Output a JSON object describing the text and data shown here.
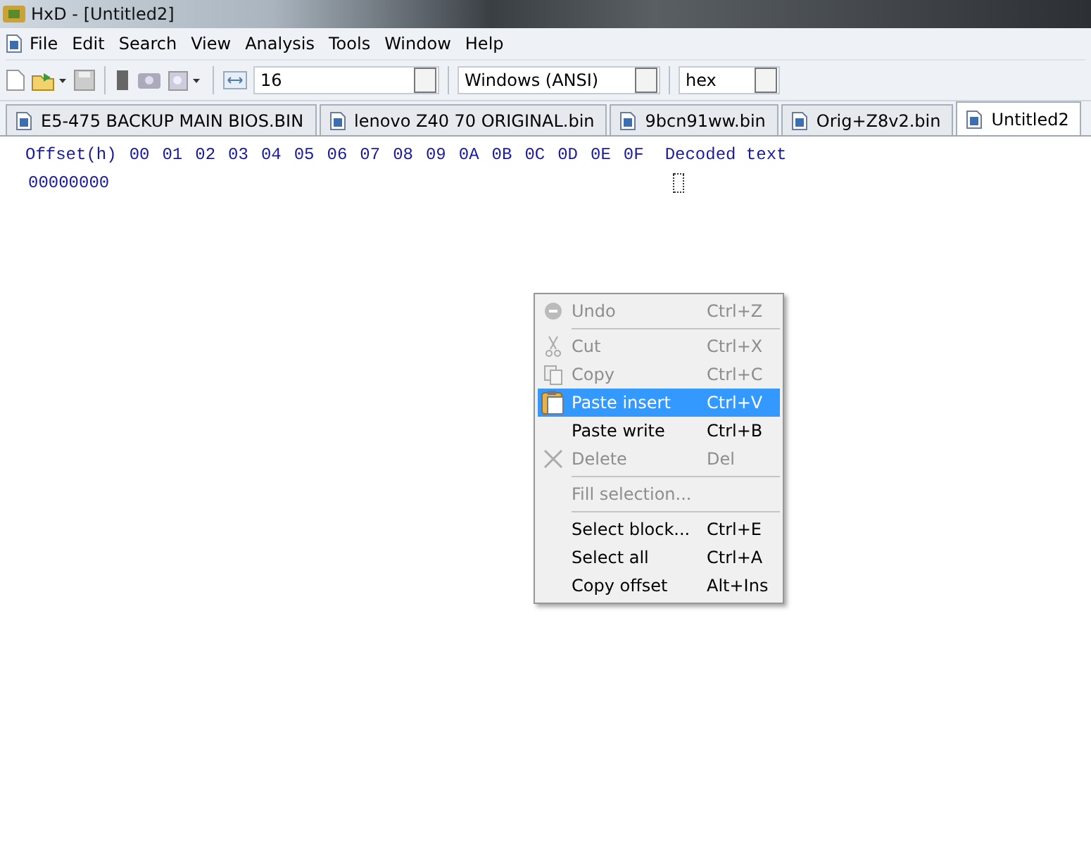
{
  "window": {
    "title": "HxD - [Untitled2]"
  },
  "menu_bar": [
    "File",
    "Edit",
    "Search",
    "View",
    "Analysis",
    "Tools",
    "Window",
    "Help"
  ],
  "toolbar": {
    "bytes_per_row": "16",
    "charset": "Windows (ANSI)",
    "offset_base": "hex"
  },
  "tabs": [
    {
      "label": "E5-475 BACKUP MAIN BIOS.BIN",
      "selected": false
    },
    {
      "label": "lenovo Z40 70 ORIGINAL.bin",
      "selected": false
    },
    {
      "label": "9bcn91ww.bin",
      "selected": false
    },
    {
      "label": "Orig+Z8v2.bin",
      "selected": false
    },
    {
      "label": "Untitled2",
      "selected": true
    }
  ],
  "hex_view": {
    "offset_header": "Offset(h)",
    "columns": [
      "00",
      "01",
      "02",
      "03",
      "04",
      "05",
      "06",
      "07",
      "08",
      "09",
      "0A",
      "0B",
      "0C",
      "0D",
      "0E",
      "0F"
    ],
    "decoded_header": "Decoded text",
    "rows": [
      "00000000"
    ]
  },
  "context_menu": [
    {
      "kind": "item",
      "label": "Undo",
      "shortcut": "Ctrl+Z",
      "disabled": true,
      "selected": false
    },
    {
      "kind": "separator"
    },
    {
      "kind": "item",
      "label": "Cut",
      "shortcut": "Ctrl+X",
      "disabled": true,
      "selected": false
    },
    {
      "kind": "item",
      "label": "Copy",
      "shortcut": "Ctrl+C",
      "disabled": true,
      "selected": false
    },
    {
      "kind": "item",
      "label": "Paste insert",
      "shortcut": "Ctrl+V",
      "disabled": false,
      "selected": true
    },
    {
      "kind": "item",
      "label": "Paste write",
      "shortcut": "Ctrl+B",
      "disabled": false,
      "selected": false
    },
    {
      "kind": "item",
      "label": "Delete",
      "shortcut": "Del",
      "disabled": true,
      "selected": false
    },
    {
      "kind": "separator"
    },
    {
      "kind": "item",
      "label": "Fill selection...",
      "disabled": true,
      "selected": false
    },
    {
      "kind": "separator"
    },
    {
      "kind": "item",
      "label": "Select block...",
      "shortcut": "Ctrl+E",
      "disabled": false,
      "selected": false
    },
    {
      "kind": "item",
      "label": "Select all",
      "shortcut": "Ctrl+A",
      "disabled": false,
      "selected": false
    },
    {
      "kind": "item",
      "label": "Copy offset",
      "shortcut": "Alt+Ins",
      "disabled": false,
      "selected": false
    }
  ]
}
